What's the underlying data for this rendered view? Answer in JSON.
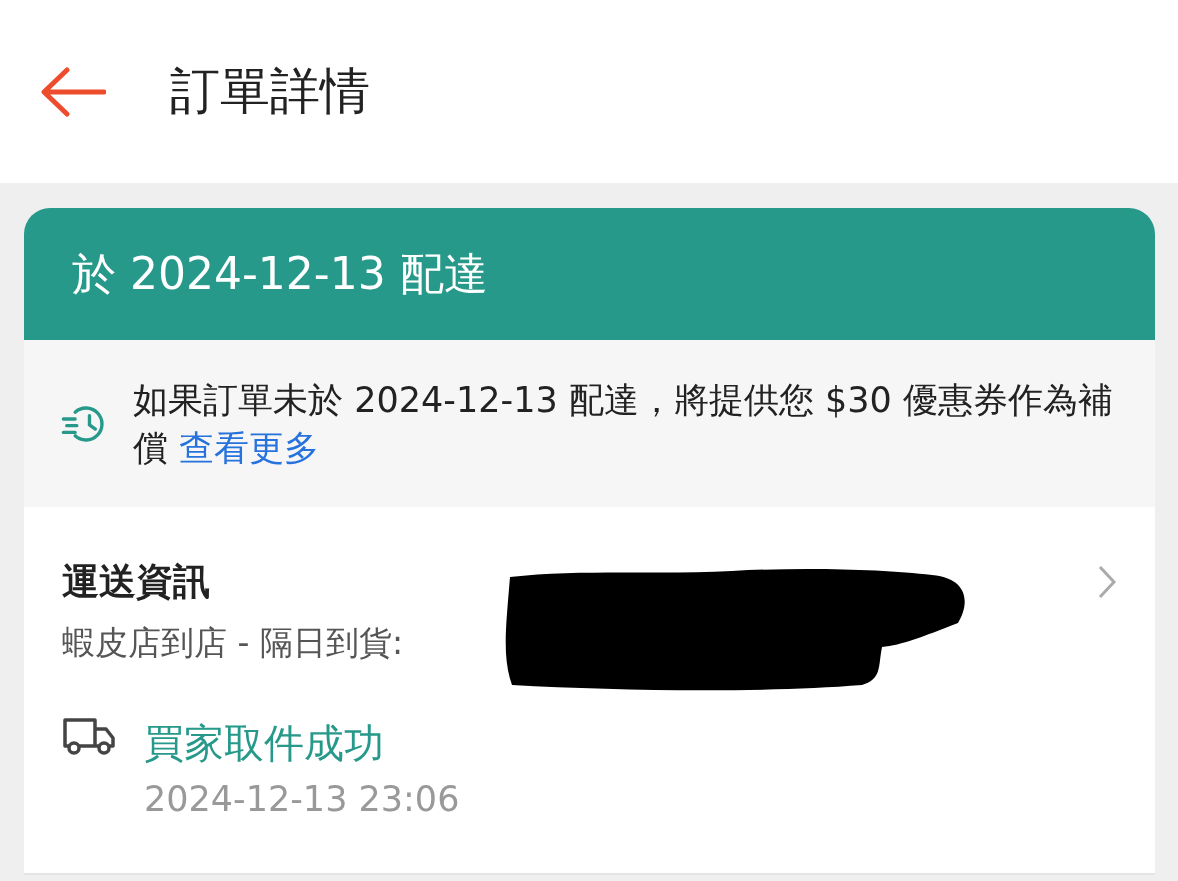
{
  "header": {
    "title": "訂單詳情"
  },
  "delivery_banner": {
    "title": "於 2024-12-13 配達"
  },
  "guarantee_notice": {
    "text": "如果訂單未於 2024-12-13 配達，將提供您 $30  優惠券作為補償",
    "link": "查看更多"
  },
  "shipping": {
    "title": "運送資訊",
    "method": "蝦皮店到店 - 隔日到貨:",
    "redacted": true,
    "status": "買家取件成功",
    "time": "2024-12-13 23:06"
  }
}
